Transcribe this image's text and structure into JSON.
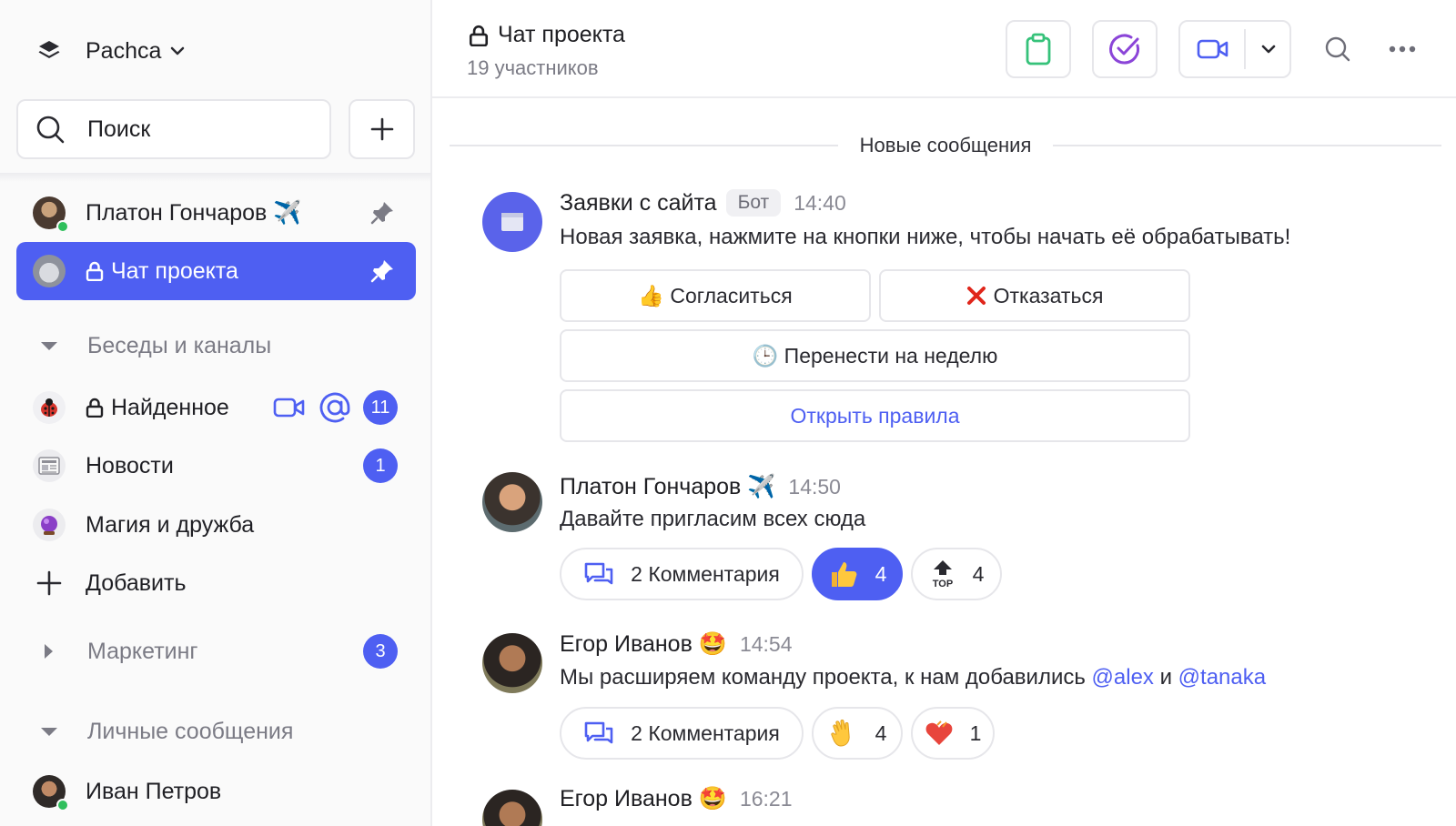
{
  "workspace": {
    "name": "Pachca"
  },
  "sidebar": {
    "search_placeholder": "Поиск",
    "pinned": [
      {
        "label": "Платон Гончаров ✈️"
      },
      {
        "label": "Чат проекта"
      }
    ],
    "section_chats": "Беседы и каналы",
    "channels": [
      {
        "label": "Найденное",
        "badge": "11"
      },
      {
        "label": "Новости",
        "badge": "1"
      },
      {
        "label": "Магия и дружба"
      }
    ],
    "add_label": "Добавить",
    "section_marketing": "Маркетинг",
    "marketing_badge": "3",
    "section_dm": "Личные сообщения",
    "dm": [
      {
        "label": "Иван Петров"
      }
    ]
  },
  "header": {
    "title": "Чат проекта",
    "subtitle": "19 участников"
  },
  "feed": {
    "divider": "Новые сообщения",
    "messages": [
      {
        "author": "Заявки с сайта",
        "tag": "Бот",
        "time": "14:40",
        "text": "Новая заявка, нажмите на кнопки ниже, чтобы начать её обрабатывать!",
        "buttons": {
          "agree": "👍 Согласиться",
          "decline": "Отказаться",
          "postpone": "🕒 Перенести на неделю",
          "rules": "Открыть правила"
        }
      },
      {
        "author": "Платон Гончаров ✈️",
        "time": "14:50",
        "text": "Давайте пригласим всех сюда",
        "comments": "2 Комментария",
        "reactions": [
          {
            "emoji": "thumbs-up",
            "count": "4"
          },
          {
            "emoji": "top-arrow",
            "count": "4"
          }
        ]
      },
      {
        "author": "Егор Иванов 🤩",
        "time": "14:54",
        "text_before": "Мы расширяем команду проекта, к нам добавились ",
        "mention1": "@alex",
        "text_and": " и ",
        "mention2": "@tanaka",
        "comments": "2 Комментария",
        "reactions": [
          {
            "emoji": "waving-hand",
            "count": "4"
          },
          {
            "emoji": "heart",
            "count": "1"
          }
        ]
      },
      {
        "author": "Егор Иванов 🤩",
        "time": "16:21"
      }
    ]
  },
  "colors": {
    "accent": "#4e5ff2",
    "online": "#2fbf5c",
    "clipboard": "#36c27a",
    "tasks": "#8b45d8"
  }
}
